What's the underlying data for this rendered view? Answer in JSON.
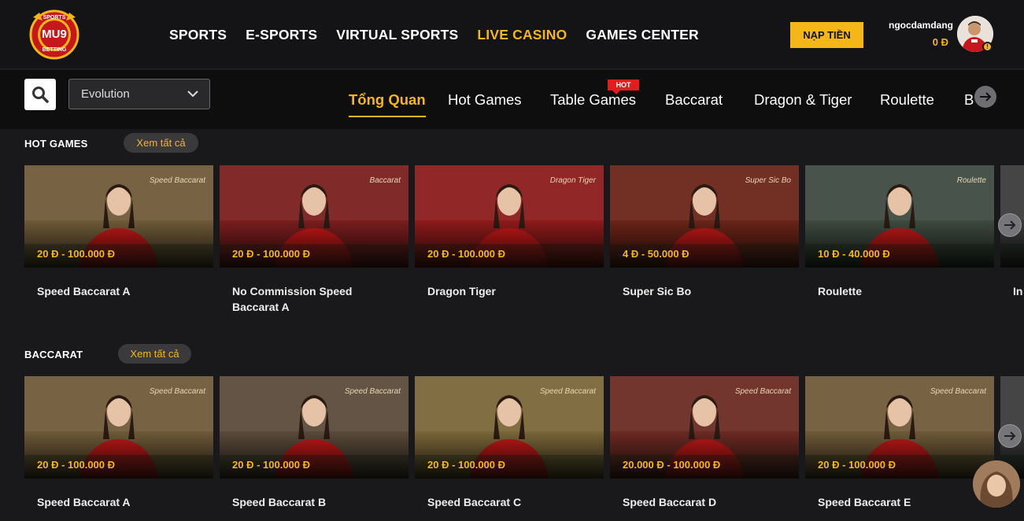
{
  "header": {
    "logo": {
      "top_text": "SPORTS",
      "main_text": "MU9",
      "bottom_text": "BETTING"
    },
    "nav": [
      {
        "label": "SPORTS",
        "active": false
      },
      {
        "label": "E-SPORTS",
        "active": false
      },
      {
        "label": "VIRTUAL SPORTS",
        "active": false
      },
      {
        "label": "LIVE CASINO",
        "active": true
      },
      {
        "label": "GAMES CENTER",
        "active": false
      }
    ],
    "deposit_label": "NẠP TIỀN",
    "username": "ngocdamdang",
    "balance": "0 Đ",
    "avatar_badge": "!"
  },
  "subbar": {
    "provider": "Evolution",
    "tabs": [
      {
        "label": "Tổng Quan",
        "active": true
      },
      {
        "label": "Hot Games",
        "active": false
      },
      {
        "label": "Table Games",
        "active": false,
        "badge": "HOT"
      },
      {
        "label": "Baccarat",
        "active": false
      },
      {
        "label": "Dragon & Tiger",
        "active": false
      },
      {
        "label": "Roulette",
        "active": false
      },
      {
        "label": "B",
        "active": false
      }
    ]
  },
  "sections": [
    {
      "title": "HOT GAMES",
      "see_all": "Xem tất cả",
      "games": [
        {
          "name": "Speed Baccarat A",
          "price": "20 Đ - 100.000 Đ",
          "brand": "Speed Baccarat",
          "bg": "#6f5a38"
        },
        {
          "name": "No Commission Speed Baccarat A",
          "price": "20 Đ - 100.000 Đ",
          "brand": "Baccarat",
          "bg": "#7a1d1d"
        },
        {
          "name": "Dragon Tiger",
          "price": "20 Đ - 100.000 Đ",
          "brand": "Dragon Tiger",
          "bg": "#8c1a1a"
        },
        {
          "name": "Super Sic Bo",
          "price": "4 Đ - 50.000 Đ",
          "brand": "Super Sic Bo",
          "bg": "#6a2418"
        },
        {
          "name": "Roulette",
          "price": "10 Đ - 40.000 Đ",
          "brand": "Roulette",
          "bg": "#3d4a40"
        },
        {
          "name": "In",
          "price": "",
          "brand": "",
          "bg": "#3a3a3a"
        }
      ]
    },
    {
      "title": "BACCARAT",
      "see_all": "Xem tất cả",
      "games": [
        {
          "name": "Speed Baccarat A",
          "price": "20 Đ - 100.000 Đ",
          "brand": "Speed Baccarat",
          "bg": "#6f5a38"
        },
        {
          "name": "Speed Baccarat B",
          "price": "20 Đ - 100.000 Đ",
          "brand": "Speed Baccarat",
          "bg": "#5a4a3a"
        },
        {
          "name": "Speed Baccarat C",
          "price": "20 Đ - 100.000 Đ",
          "brand": "Speed Baccarat",
          "bg": "#7a6638"
        },
        {
          "name": "Speed Baccarat D",
          "price": "20.000 Đ - 100.000 Đ",
          "brand": "Speed Baccarat",
          "bg": "#6b2a22"
        },
        {
          "name": "Speed Baccarat E",
          "price": "20 Đ - 100.000 Đ",
          "brand": "Speed Baccarat",
          "bg": "#6f5a38"
        },
        {
          "name": "",
          "price": "",
          "brand": "",
          "bg": "#3a3a3a"
        }
      ]
    }
  ],
  "colors": {
    "accent": "#f5b617",
    "background": "#19191b",
    "header": "#141416",
    "hot": "#e01e1e"
  }
}
